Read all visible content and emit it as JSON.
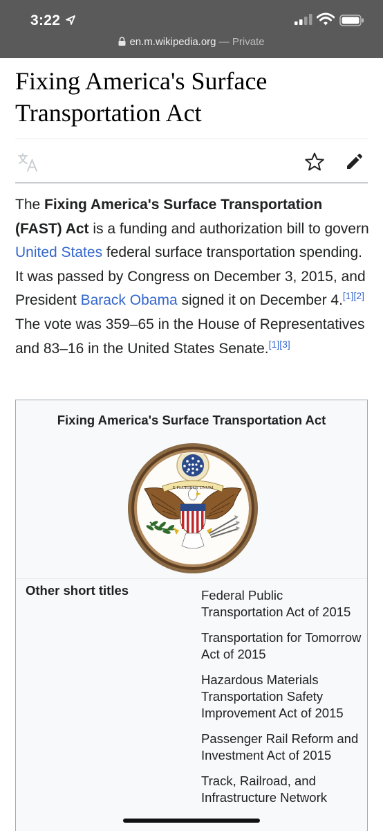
{
  "status_bar": {
    "time": "3:22"
  },
  "browser": {
    "domain": "en.m.wikipedia.org",
    "separator": " — ",
    "mode": "Private"
  },
  "article": {
    "title_line1": "Fixing America's Surface",
    "title_line2": "Transportation Act",
    "lead": {
      "t1": "The ",
      "bold": "Fixing America's Surface Transportation (FAST) Act",
      "t2": " is a funding and authorization bill to govern ",
      "link_us": "United States",
      "t3": " federal surface transportation spending. It was passed by Congress on December 3, 2015, and President ",
      "link_obama": "Barack Obama",
      "t4": " signed it on December 4.",
      "ref1": "[1]",
      "ref2": "[2]",
      "t5": " The vote was 359–65 in the House of Representatives and 83–16 in the United States Senate.",
      "ref3": "[1]",
      "ref4": "[3]"
    }
  },
  "infobox": {
    "title": "Fixing America's Surface Transportation Act",
    "seal_motto": "E PLURIBUS UNUM",
    "row_label": "Other short titles",
    "short_titles": [
      "Federal Public Transportation Act of 2015",
      "Transportation for Tomorrow Act of 2015",
      "Hazardous Materials Transportation Safety Improvement Act of 2015",
      "Passenger Rail Reform and Investment Act of 2015",
      "Track, Railroad, and Infrastructure Network"
    ]
  },
  "icons": {
    "language": "language-icon",
    "watch": "star-icon",
    "edit": "pencil-icon"
  },
  "colors": {
    "link": "#3366cc",
    "status_bar": "#5a5a5a",
    "infobox_bg": "#f8f9fa"
  }
}
